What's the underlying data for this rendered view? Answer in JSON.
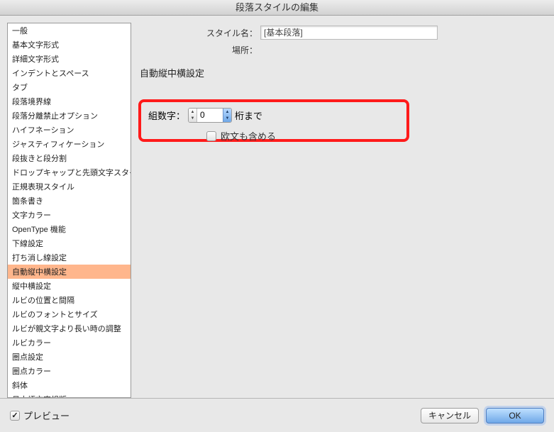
{
  "title": "段落スタイルの編集",
  "header": {
    "style_name_label": "スタイル名：",
    "style_name_value": "[基本段落]",
    "location_label": "場所："
  },
  "sidebar": {
    "items": [
      "一般",
      "基本文字形式",
      "詳細文字形式",
      "インデントとスペース",
      "タブ",
      "段落境界線",
      "段落分離禁止オプション",
      "ハイフネーション",
      "ジャスティフィケーション",
      "段抜きと段分割",
      "ドロップキャップと先頭文字スタイル",
      "正規表現スタイル",
      "箇条書き",
      "文字カラー",
      "OpenType 機能",
      "下線設定",
      "打ち消し線設定",
      "自動縦中横設定",
      "縦中横設定",
      "ルビの位置と間隔",
      "ルビのフォントとサイズ",
      "ルビが親文字より長い時の調整",
      "ルビカラー",
      "圏点設定",
      "圏点カラー",
      "斜体",
      "日本語文字組版"
    ],
    "selected_index": 17
  },
  "section": {
    "title": "自動縦中横設定",
    "digits_label": "組数字：",
    "digits_value": "0",
    "digits_suffix": "桁まで",
    "include_label": "欧文も含める"
  },
  "footer": {
    "preview_label": "プレビュー",
    "cancel": "キャンセル",
    "ok": "OK"
  }
}
